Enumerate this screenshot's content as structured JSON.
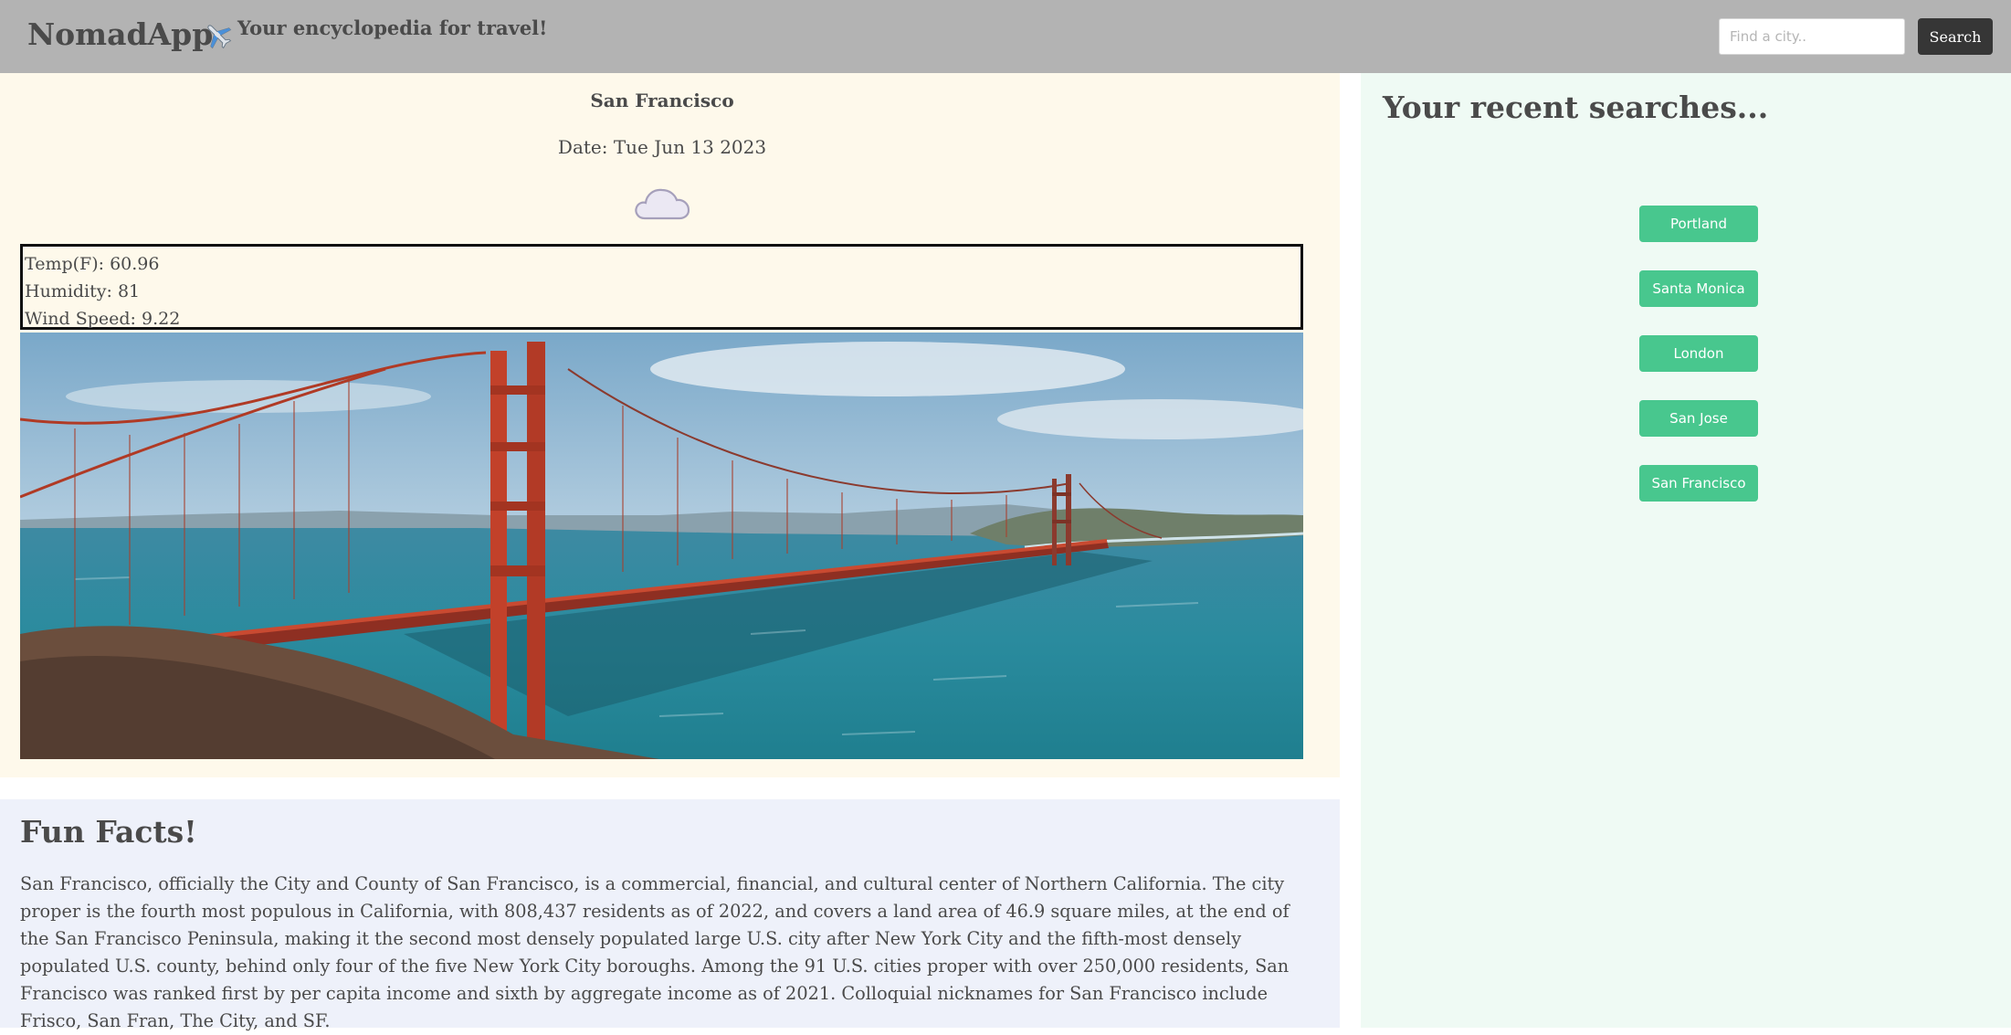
{
  "header": {
    "brand": "NomadApp",
    "tagline": "Your encyclopedia for travel!",
    "search_placeholder": "Find a city..",
    "search_button": "Search"
  },
  "weather": {
    "city": "San Francisco",
    "date": "Date: Tue Jun 13 2023",
    "icon": "cloud-icon",
    "temp": "Temp(F): 60.96",
    "humidity": "Humidity: 81",
    "wind": "Wind Speed: 9.22",
    "photo": "golden-gate-bridge-photo"
  },
  "facts": {
    "heading": "Fun Facts!",
    "text": "San Francisco, officially the City and County of San Francisco, is a commercial, financial, and cultural center of Northern California. The city proper is the fourth most populous in California, with 808,437 residents as of 2022, and covers a land area of 46.9 square miles, at the end of the San Francisco Peninsula, making it the second most densely populated large U.S. city after New York City and the fifth-most densely populated U.S. county, behind only four of the five New York City boroughs. Among the 91 U.S. cities proper with over 250,000 residents, San Francisco was ranked first by per capita income and sixth by aggregate income as of 2021. Colloquial nicknames for San Francisco include Frisco, San Fran, The City, and SF."
  },
  "recent": {
    "heading": "Your recent searches...",
    "items": [
      "Portland",
      "Santa Monica",
      "London",
      "San Jose",
      "San Francisco"
    ]
  },
  "colors": {
    "header_bg": "#b3b3b3",
    "city_bg": "#fef9eb",
    "facts_bg": "#eef1fa",
    "recent_bg": "#effaf4",
    "accent_green": "#48c78e",
    "search_button_bg": "#363636"
  }
}
